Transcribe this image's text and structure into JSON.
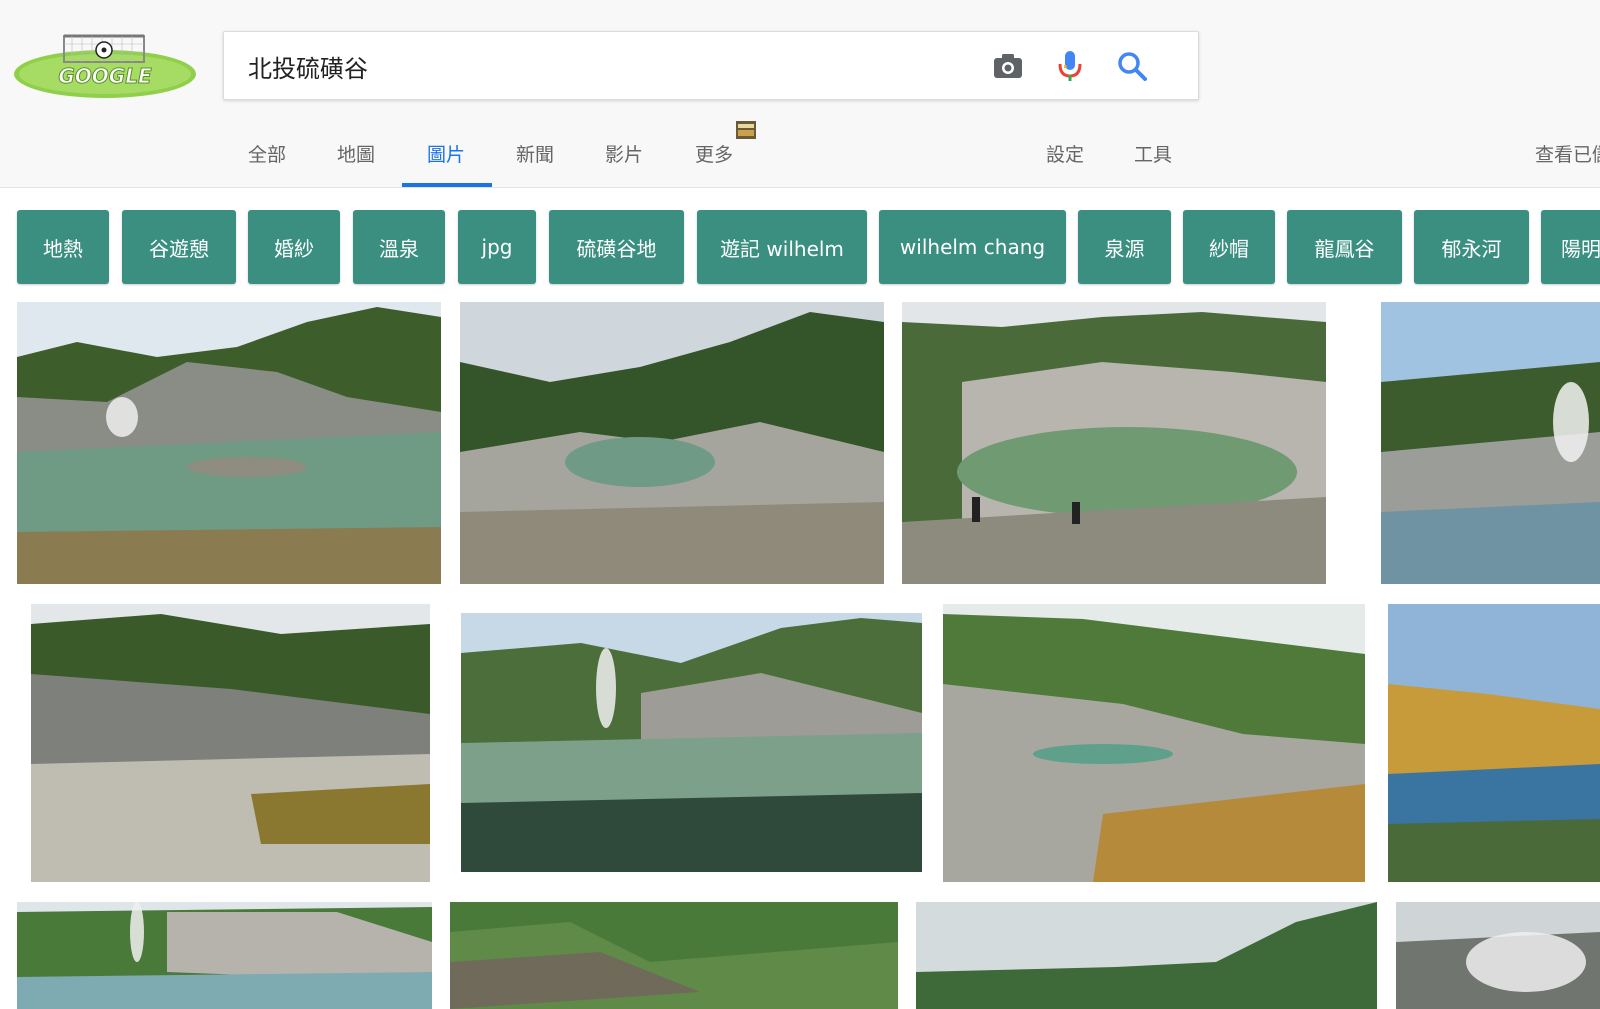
{
  "search": {
    "query": "北投硫磺谷"
  },
  "logo": {
    "text": "GOOGLE"
  },
  "tabs": [
    {
      "label": "全部"
    },
    {
      "label": "地圖"
    },
    {
      "label": "圖片"
    },
    {
      "label": "新聞"
    },
    {
      "label": "影片"
    },
    {
      "label": "更多"
    },
    {
      "label": "設定"
    },
    {
      "label": "工具"
    },
    {
      "label": "查看已儲"
    }
  ],
  "chips": [
    {
      "label": "地熱"
    },
    {
      "label": "谷遊憩"
    },
    {
      "label": "婚紗"
    },
    {
      "label": "溫泉"
    },
    {
      "label": "jpg"
    },
    {
      "label": "硫磺谷地"
    },
    {
      "label": "遊記 wilhelm"
    },
    {
      "label": "wilhelm chang"
    },
    {
      "label": "泉源"
    },
    {
      "label": "紗帽"
    },
    {
      "label": "龍鳳谷"
    },
    {
      "label": "郁永河"
    },
    {
      "label": "陽明"
    }
  ],
  "colors": {
    "accent": "#1a73e8",
    "chip_bg": "#3a8f80",
    "header_bg": "#f8f8f8"
  },
  "icons": [
    "camera-icon",
    "microphone-icon",
    "search-icon"
  ]
}
